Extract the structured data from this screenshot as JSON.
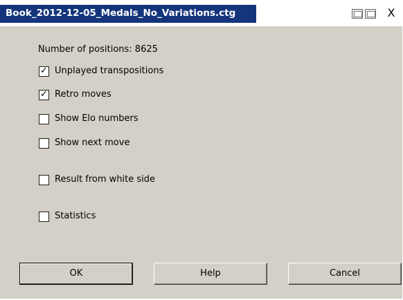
{
  "window": {
    "title": "Book_2012-12-05_Medals_No_Variations.ctg",
    "close_label": "X",
    "icons": [
      "window-restore-icon",
      "window-tile-icon"
    ]
  },
  "info": {
    "positions_text": "Number of positions: 8625"
  },
  "options": [
    {
      "label": "Unplayed transpositions",
      "checked": true
    },
    {
      "label": "Retro moves",
      "checked": true
    },
    {
      "label": "Show Elo numbers",
      "checked": false
    },
    {
      "label": "Show next move",
      "checked": false
    },
    {
      "label": "Result from white side",
      "checked": false
    },
    {
      "label": "Statistics",
      "checked": false
    }
  ],
  "buttons": {
    "ok": "OK",
    "help": "Help",
    "cancel": "Cancel"
  },
  "check_glyph": "✓"
}
